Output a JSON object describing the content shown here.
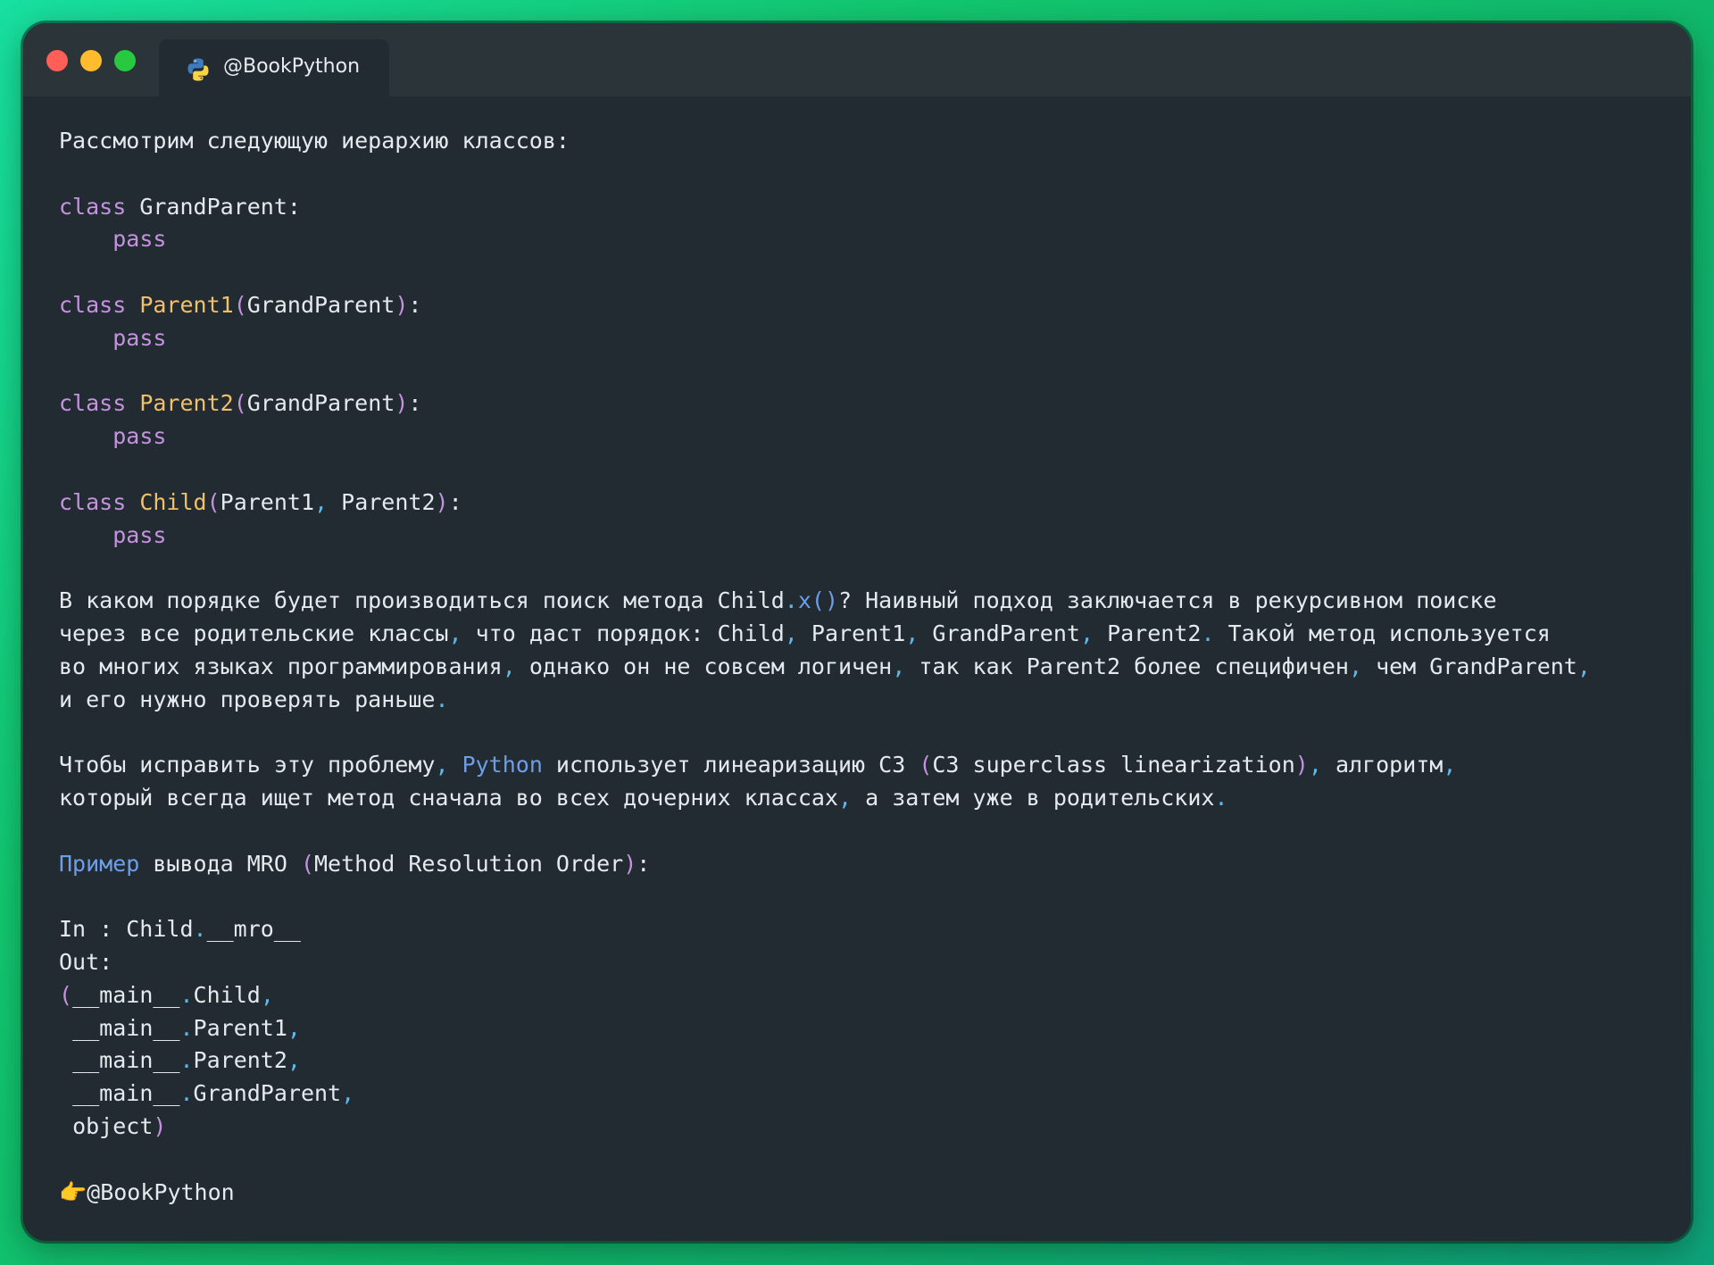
{
  "window": {
    "tab_title": "@BookPython",
    "tab_icon": "python-logo-icon",
    "traffic_lights": [
      "close",
      "minimize",
      "zoom"
    ],
    "colors": {
      "background": "#212b31",
      "titlebar": "#2a3439",
      "keyword": "#c692e0",
      "class_name": "#f3c06a",
      "punctuation": "#5fb8e8",
      "link": "#6f9ee8"
    }
  },
  "post": {
    "intro": "Рассмотрим следующую иерархию классов:",
    "code": {
      "kw_class": "class",
      "kw_pass": "pass",
      "c1_name": "GrandParent",
      "c1_colon": ":",
      "c2_name": "Parent1",
      "c2_base": "GrandParent",
      "c3_name": "Parent2",
      "c3_base": "GrandParent",
      "c4_name": "Child",
      "c4_base1": "Parent1",
      "c4_base2": "Parent2",
      "lparen": "(",
      "rparen": ")",
      "colon": ":",
      "comma": ","
    },
    "para1": {
      "l1_a": "В каком порядке будет производиться поиск метода Child",
      "l1_dot": ".",
      "l1_call": "x()",
      "l1_b": "? Наивный подход заключается в рекурсивном поиске",
      "l2_a": "через все родительские классы",
      "l2_c1": ",",
      "l2_b": " что даст порядок: Child",
      "l2_c2": ",",
      "l2_c": " Parent1",
      "l2_c3": ",",
      "l2_d": " GrandParent",
      "l2_c4": ",",
      "l2_e": " Parent2",
      "l2_dot": ".",
      "l2_f": " Такой метод используется",
      "l3_a": "во многих языках программирования",
      "l3_c1": ",",
      "l3_b": " однако он не совсем логичен",
      "l3_c2": ",",
      "l3_c": " так как Parent2 более специфичен",
      "l3_c3": ",",
      "l3_d": " чем GrandParent",
      "l3_c4": ",",
      "l4_a": "и его нужно проверять раньше",
      "l4_dot": "."
    },
    "para2": {
      "l1_a": "Чтобы исправить эту проблему",
      "l1_c1": ",",
      "l1_link": "Python",
      "l1_b": " использует линеаризацию C3 ",
      "l1_lp": "(",
      "l1_c": "C3 superclass linearization",
      "l1_rp": ")",
      "l1_c2": ",",
      "l1_d": " алгоритм",
      "l1_c3": ",",
      "l2_a": "который всегда ищет метод сначала во всех дочерних классах",
      "l2_c1": ",",
      "l2_b": " а затем уже в родительских",
      "l2_dot": "."
    },
    "example": {
      "link": "Пример",
      "a": " вывода MRO ",
      "lp": "(",
      "b": "Method Resolution Order",
      "rp": ")",
      "colon": ":"
    },
    "mro": {
      "in_a": "In : Child",
      "in_dot": ".",
      "in_b": "__mro__",
      "out": "Out:",
      "lp": "(",
      "main": "__main__",
      "dot": ".",
      "comma": ",",
      "r1": "Child",
      "r2": "Parent1",
      "r3": "Parent2",
      "r4": "GrandParent",
      "r5": "object",
      "rp": ")"
    },
    "footer": {
      "emoji": "👉",
      "handle": "@BookPython"
    }
  }
}
